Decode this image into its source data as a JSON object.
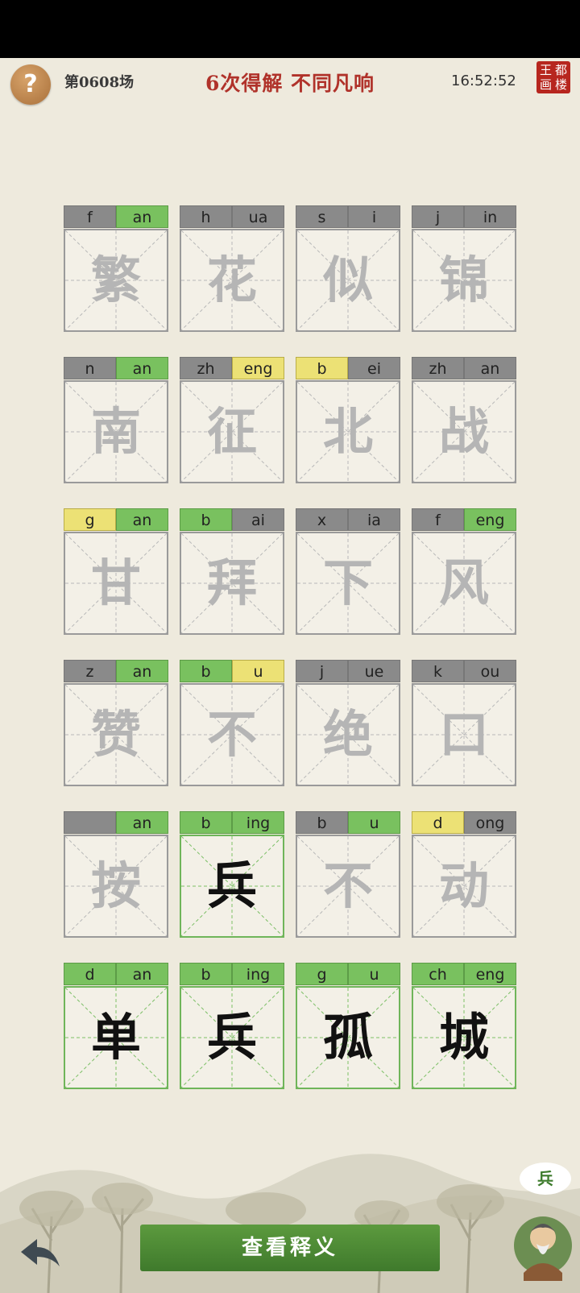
{
  "header": {
    "help_icon": "?",
    "round_label": "第0608场",
    "title": "6次得解  不同凡响",
    "clock": "16:52:52",
    "seal_chars": [
      "王",
      "都",
      "画",
      "楼"
    ]
  },
  "colors": {
    "correct": "#79c15f",
    "present": "#ece175",
    "absent": "#8a8a8a",
    "title": "#b0322a"
  },
  "rows": [
    [
      {
        "initial": "f",
        "final": "an",
        "i_state": "n",
        "f_state": "g",
        "char": "繁",
        "solved": false
      },
      {
        "initial": "h",
        "final": "ua",
        "i_state": "n",
        "f_state": "n",
        "char": "花",
        "solved": false
      },
      {
        "initial": "s",
        "final": "i",
        "i_state": "n",
        "f_state": "n",
        "char": "似",
        "solved": false
      },
      {
        "initial": "j",
        "final": "in",
        "i_state": "n",
        "f_state": "n",
        "char": "锦",
        "solved": false
      }
    ],
    [
      {
        "initial": "n",
        "final": "an",
        "i_state": "n",
        "f_state": "g",
        "char": "南",
        "solved": false
      },
      {
        "initial": "zh",
        "final": "eng",
        "i_state": "n",
        "f_state": "y",
        "char": "征",
        "solved": false
      },
      {
        "initial": "b",
        "final": "ei",
        "i_state": "y",
        "f_state": "n",
        "char": "北",
        "solved": false
      },
      {
        "initial": "zh",
        "final": "an",
        "i_state": "n",
        "f_state": "n",
        "char": "战",
        "solved": false
      }
    ],
    [
      {
        "initial": "g",
        "final": "an",
        "i_state": "y",
        "f_state": "g",
        "char": "甘",
        "solved": false
      },
      {
        "initial": "b",
        "final": "ai",
        "i_state": "g",
        "f_state": "n",
        "char": "拜",
        "solved": false
      },
      {
        "initial": "x",
        "final": "ia",
        "i_state": "n",
        "f_state": "n",
        "char": "下",
        "solved": false
      },
      {
        "initial": "f",
        "final": "eng",
        "i_state": "n",
        "f_state": "g",
        "char": "风",
        "solved": false
      }
    ],
    [
      {
        "initial": "z",
        "final": "an",
        "i_state": "n",
        "f_state": "g",
        "char": "赞",
        "solved": false
      },
      {
        "initial": "b",
        "final": "u",
        "i_state": "g",
        "f_state": "y",
        "char": "不",
        "solved": false
      },
      {
        "initial": "j",
        "final": "ue",
        "i_state": "n",
        "f_state": "n",
        "char": "绝",
        "solved": false
      },
      {
        "initial": "k",
        "final": "ou",
        "i_state": "n",
        "f_state": "n",
        "char": "口",
        "solved": false
      }
    ],
    [
      {
        "initial": "",
        "final": "an",
        "i_state": "n",
        "f_state": "g",
        "char": "按",
        "solved": false
      },
      {
        "initial": "b",
        "final": "ing",
        "i_state": "g",
        "f_state": "g",
        "char": "兵",
        "solved": true
      },
      {
        "initial": "b",
        "final": "u",
        "i_state": "n",
        "f_state": "g",
        "char": "不",
        "solved": false
      },
      {
        "initial": "d",
        "final": "ong",
        "i_state": "y",
        "f_state": "n",
        "char": "动",
        "solved": false
      }
    ],
    [
      {
        "initial": "d",
        "final": "an",
        "i_state": "g",
        "f_state": "g",
        "char": "单",
        "solved": true
      },
      {
        "initial": "b",
        "final": "ing",
        "i_state": "g",
        "f_state": "g",
        "char": "兵",
        "solved": true
      },
      {
        "initial": "g",
        "final": "u",
        "i_state": "g",
        "f_state": "g",
        "char": "孤",
        "solved": true
      },
      {
        "initial": "ch",
        "final": "eng",
        "i_state": "g",
        "f_state": "g",
        "char": "城",
        "solved": true
      }
    ]
  ],
  "footer": {
    "button_label": "查看释义",
    "hint_bubble": "兵",
    "back_icon": "back-arrow-icon",
    "avatar_icon": "sage-avatar-icon"
  }
}
